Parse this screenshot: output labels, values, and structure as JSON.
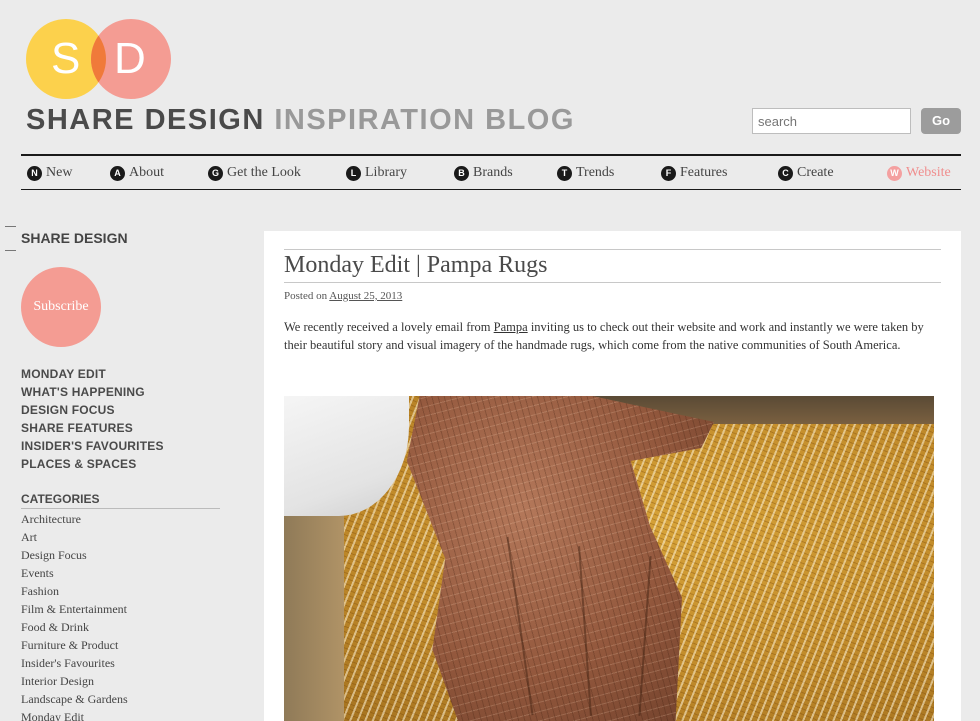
{
  "brand": {
    "logo_letters": [
      "S",
      "D"
    ],
    "title_dark": "SHARE DESIGN",
    "title_light": "INSPIRATION BLOG",
    "colors": {
      "yellow": "#fcd14c",
      "pink": "#f49c93",
      "orange_overlap": "#f07a3a"
    }
  },
  "search": {
    "placeholder": "search",
    "button_label": "Go"
  },
  "nav": {
    "items": [
      {
        "badge": "N",
        "label": "New"
      },
      {
        "badge": "A",
        "label": "About"
      },
      {
        "badge": "G",
        "label": "Get the Look"
      },
      {
        "badge": "L",
        "label": "Library"
      },
      {
        "badge": "B",
        "label": "Brands"
      },
      {
        "badge": "T",
        "label": "Trends"
      },
      {
        "badge": "F",
        "label": "Features"
      },
      {
        "badge": "C",
        "label": "Create"
      },
      {
        "badge": "W",
        "label": "Website"
      }
    ]
  },
  "sidebar": {
    "heading": "SHARE DESIGN",
    "subscribe_label": "Subscribe",
    "sections": [
      "MONDAY EDIT",
      "WHAT'S HAPPENING",
      "DESIGN FOCUS",
      "SHARE FEATURES",
      "INSIDER'S FAVOURITES",
      "PLACES & SPACES"
    ],
    "categories_heading": "CATEGORIES",
    "categories": [
      "Architecture",
      "Art",
      "Design Focus",
      "Events",
      "Fashion",
      "Film & Entertainment",
      "Food & Drink",
      "Furniture & Product",
      "Insider's Favourites",
      "Interior Design",
      "Landscape & Gardens",
      "Monday Edit"
    ]
  },
  "post": {
    "title": "Monday Edit | Pampa Rugs",
    "posted_on_label": "Posted on",
    "date": "August 25, 2013",
    "body_before_link": "We recently received a lovely email from ",
    "link_text": "Pampa",
    "body_after_link": " inviting us to check out their website and work and instantly we were taken by their beautiful story and visual imagery of the handmade rugs, which come from the native communities of South America."
  }
}
